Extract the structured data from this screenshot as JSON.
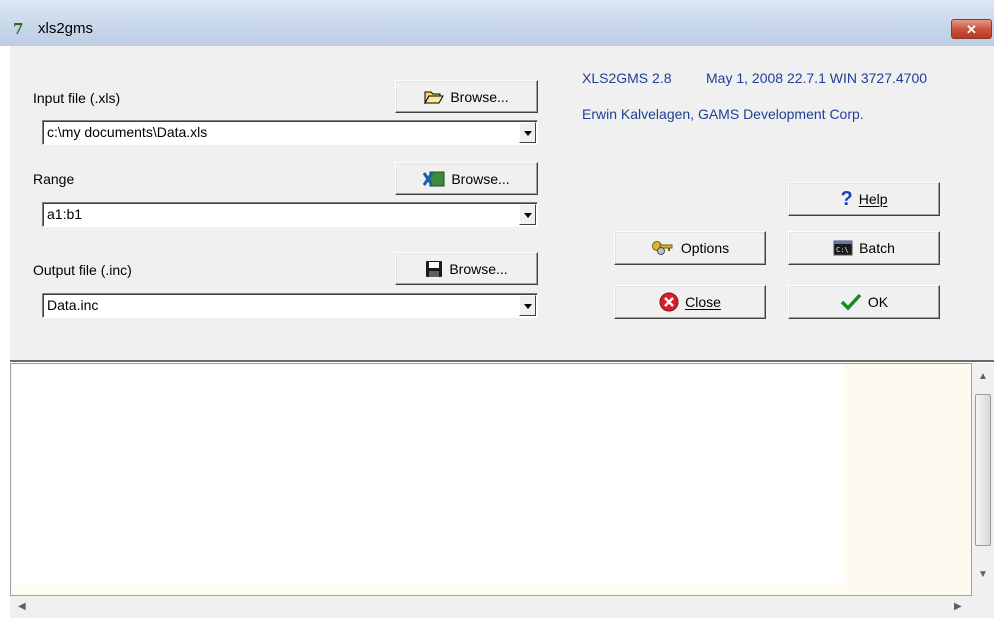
{
  "window": {
    "title": "xls2gms",
    "close_glyph": "✕"
  },
  "input": {
    "label": "Input file (.xls)",
    "browse_label": "Browse...",
    "value": "c:\\my documents\\Data.xls"
  },
  "range": {
    "label": "Range",
    "browse_label": "Browse...",
    "value": "a1:b1"
  },
  "output": {
    "label": "Output file (.inc)",
    "browse_label": "Browse...",
    "value": "Data.inc"
  },
  "info": {
    "line1a": "XLS2GMS 2.8",
    "line1b": "May  1, 2008 22.7.1 WIN 3727.4700",
    "line2": "Erwin Kalvelagen, GAMS Development Corp."
  },
  "buttons": {
    "help": "Help",
    "options": "Options",
    "batch": "Batch",
    "close": "Close",
    "ok": "OK"
  },
  "icons": {
    "open_folder": "open-folder-icon",
    "excel": "excel-icon",
    "save": "floppy-disk-icon",
    "help": "question-icon",
    "options": "keys-icon",
    "batch": "console-icon",
    "close": "red-x-circle-icon",
    "ok": "checkmark-icon"
  },
  "colors": {
    "info_text": "#1f3f97",
    "memo_bg": "#fffaf0",
    "titlebar": "#c7d6ea"
  }
}
